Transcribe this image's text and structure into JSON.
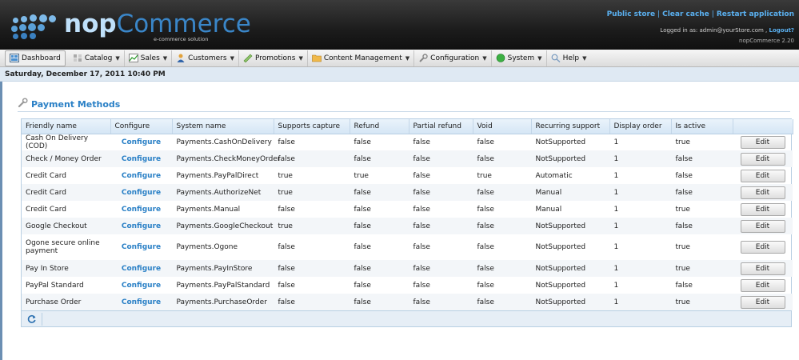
{
  "header": {
    "logo_main": "nop",
    "logo_rest": "Commerce",
    "logo_sub": "e-commerce solution",
    "links": [
      "Public store",
      "Clear cache",
      "Restart application"
    ],
    "logged_in_prefix": "Logged in as: admin@yourStore.com ,",
    "logout": "Logout?",
    "version": "nopCommerce 2.20"
  },
  "menu": {
    "dashboard": "Dashboard",
    "catalog": "Catalog",
    "sales": "Sales",
    "customers": "Customers",
    "promotions": "Promotions",
    "content": "Content Management",
    "configuration": "Configuration",
    "system": "System",
    "help": "Help"
  },
  "date": "Saturday, December 17, 2011 10:40 PM",
  "page_title": "Payment Methods",
  "table": {
    "headers": [
      "Friendly name",
      "Configure",
      "System name",
      "Supports capture",
      "Refund",
      "Partial refund",
      "Void",
      "Recurring support",
      "Display order",
      "Is active",
      ""
    ],
    "configure_label": "Configure",
    "edit_label": "Edit",
    "rows": [
      {
        "friendly": "Cash On Delivery (COD)",
        "system": "Payments.CashOnDelivery",
        "capture": "false",
        "refund": "false",
        "partial": "false",
        "void": "false",
        "recurring": "NotSupported",
        "order": "1",
        "active": "true"
      },
      {
        "friendly": "Check / Money Order",
        "system": "Payments.CheckMoneyOrder",
        "capture": "false",
        "refund": "false",
        "partial": "false",
        "void": "false",
        "recurring": "NotSupported",
        "order": "1",
        "active": "false"
      },
      {
        "friendly": "Credit Card",
        "system": "Payments.PayPalDirect",
        "capture": "true",
        "refund": "true",
        "partial": "false",
        "void": "true",
        "recurring": "Automatic",
        "order": "1",
        "active": "false"
      },
      {
        "friendly": "Credit Card",
        "system": "Payments.AuthorizeNet",
        "capture": "true",
        "refund": "false",
        "partial": "false",
        "void": "false",
        "recurring": "Manual",
        "order": "1",
        "active": "false"
      },
      {
        "friendly": "Credit Card",
        "system": "Payments.Manual",
        "capture": "false",
        "refund": "false",
        "partial": "false",
        "void": "false",
        "recurring": "Manual",
        "order": "1",
        "active": "true"
      },
      {
        "friendly": "Google Checkout",
        "system": "Payments.GoogleCheckout",
        "capture": "true",
        "refund": "false",
        "partial": "false",
        "void": "false",
        "recurring": "NotSupported",
        "order": "1",
        "active": "false"
      },
      {
        "friendly": "Ogone secure online payment",
        "system": "Payments.Ogone",
        "capture": "false",
        "refund": "false",
        "partial": "false",
        "void": "false",
        "recurring": "NotSupported",
        "order": "1",
        "active": "true"
      },
      {
        "friendly": "Pay In Store",
        "system": "Payments.PayInStore",
        "capture": "false",
        "refund": "false",
        "partial": "false",
        "void": "false",
        "recurring": "NotSupported",
        "order": "1",
        "active": "true"
      },
      {
        "friendly": "PayPal Standard",
        "system": "Payments.PayPalStandard",
        "capture": "false",
        "refund": "false",
        "partial": "false",
        "void": "false",
        "recurring": "NotSupported",
        "order": "1",
        "active": "false"
      },
      {
        "friendly": "Purchase Order",
        "system": "Payments.PurchaseOrder",
        "capture": "false",
        "refund": "false",
        "partial": "false",
        "void": "false",
        "recurring": "NotSupported",
        "order": "1",
        "active": "true"
      }
    ]
  },
  "colors": {
    "accent": "#2a80c6",
    "header_bg": "#1c1c1c",
    "link": "#5ab0f0"
  }
}
